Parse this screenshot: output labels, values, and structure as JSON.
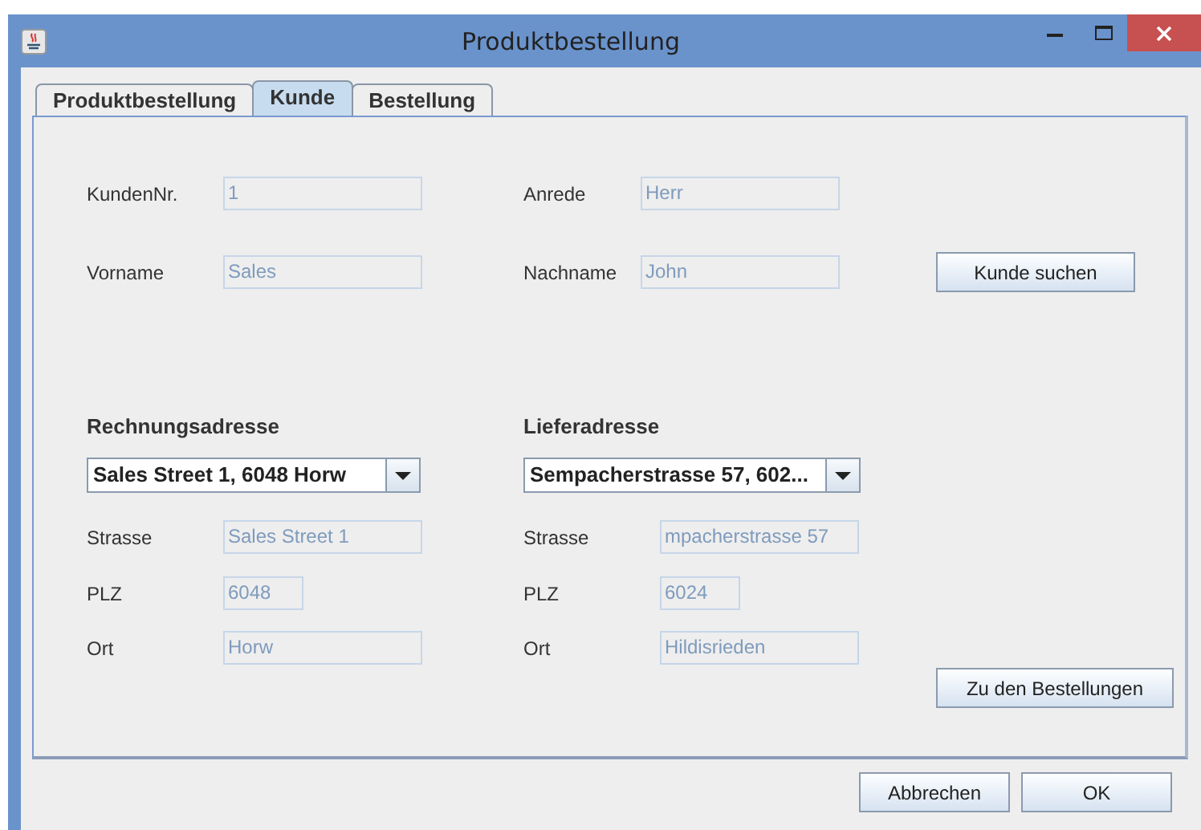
{
  "window": {
    "title": "Produktbestellung"
  },
  "tabs": [
    {
      "label": "Produktbestellung",
      "selected": false
    },
    {
      "label": "Kunde",
      "selected": true
    },
    {
      "label": "Bestellung",
      "selected": false
    }
  ],
  "customer": {
    "fields": [
      {
        "label": "KundenNr.",
        "value": "1",
        "disabled": true
      },
      {
        "label": "Anrede",
        "value": "Herr",
        "disabled": true
      },
      {
        "label": "Vorname",
        "value": "Sales",
        "disabled": true
      },
      {
        "label": "Nachname",
        "value": "John",
        "disabled": true
      }
    ],
    "search_button": "Kunde suchen"
  },
  "addresses": [
    {
      "heading": "Rechnungsadresse",
      "combo": "Sales Street 1, 6048 Horw",
      "fields": [
        {
          "label": "Strasse",
          "value": "Sales Street 1",
          "disabled": true
        },
        {
          "label": "PLZ",
          "value": "6048",
          "disabled": true
        },
        {
          "label": "Ort",
          "value": "Horw",
          "disabled": true
        }
      ]
    },
    {
      "heading": "Lieferadresse",
      "combo": "Sempacherstrasse 57, 602...",
      "fields": [
        {
          "label": "Strasse",
          "value": "mpacherstrasse 57",
          "disabled": true
        },
        {
          "label": "PLZ",
          "value": "6024",
          "disabled": true
        },
        {
          "label": "Ort",
          "value": "Hildisrieden",
          "disabled": true
        }
      ]
    }
  ],
  "orders_button": "Zu den Bestellungen",
  "buttons": [
    "Abbrechen",
    "OK"
  ]
}
